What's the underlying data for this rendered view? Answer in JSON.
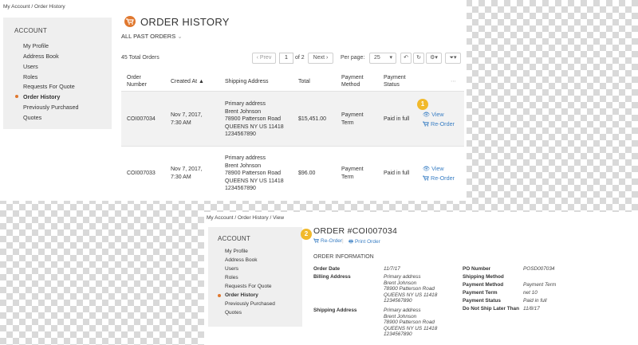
{
  "order_history": {
    "breadcrumb": "My Account / Order History",
    "sidebar": {
      "title": "ACCOUNT",
      "items": [
        "My Profile",
        "Address Book",
        "Users",
        "Roles",
        "Requests For Quote",
        "Order History",
        "Previously Purchased",
        "Quotes"
      ],
      "active": "Order History"
    },
    "page_title": "ORDER HISTORY",
    "filter_label": "ALL PAST ORDERS",
    "total": "45 Total Orders",
    "pager": {
      "prev": "‹ Prev",
      "page": "1",
      "of": "of 2",
      "next": "Next ›",
      "per_page_label": "Per page:",
      "per_page_value": "25"
    },
    "columns": [
      "Order\nNumber",
      "Created At ▲",
      "Shipping Address",
      "Total",
      "Payment\nMethod",
      "Payment\nStatus",
      "⋯"
    ],
    "orders": [
      {
        "number": "COI007034",
        "created": "Nov 7, 2017,\n7:30 AM",
        "address": "Primary address\nBrent Johnson\n78900 Patterson Road\nQUEENS NY US 11418\n1234567890",
        "total": "$15,451.00",
        "method": "Payment\nTerm",
        "status": "Paid in full",
        "view": "View",
        "reorder": "Re-Order"
      },
      {
        "number": "COI007033",
        "created": "Nov 7, 2017,\n7:30 AM",
        "address": "Primary address\nBrent Johnson\n78900 Patterson Road\nQUEENS NY US 11418\n1234567890",
        "total": "$96.00",
        "method": "Payment\nTerm",
        "status": "Paid in full",
        "view": "View",
        "reorder": "Re-Order"
      }
    ],
    "badge": "1"
  },
  "order_view": {
    "breadcrumb": "My Account / Order History / View",
    "sidebar": {
      "title": "ACCOUNT",
      "items": [
        "My Profile",
        "Address Book",
        "Users",
        "Roles",
        "Requests For Quote",
        "Order History",
        "Previously Purchased",
        "Quotes"
      ],
      "active": "Order History"
    },
    "title": "ORDER #COI007034",
    "reorder": "Re-Order",
    "print": "Print Order",
    "badge": "2",
    "section": "ORDER INFORMATION",
    "left": [
      {
        "label": "Order Date",
        "value": "11/7/17"
      },
      {
        "label": "Billing Address",
        "value": "Primary address\nBrent Johnson\n78900 Patterson Road\nQUEENS NY US 11418\n1234567890"
      },
      {
        "label": "Shipping Address",
        "value": "Primary address\nBrent Johnson\n78900 Patterson Road\nQUEENS NY US 11418\n1234567890"
      }
    ],
    "right": [
      {
        "label": "PO Number",
        "value": "POSD007034"
      },
      {
        "label": "Shipping Method",
        "value": ""
      },
      {
        "label": "Payment Method",
        "value": "Payment Term"
      },
      {
        "label": "Payment Term",
        "value": "net 10"
      },
      {
        "label": "Payment Status",
        "value": "Paid in full"
      },
      {
        "label": "Do Not Ship Later Than",
        "value": "11/8/17"
      }
    ]
  },
  "colors": {
    "accent": "#e0782f",
    "link": "#3a7fc4",
    "badge": "#f1b92b",
    "sidebar_bg": "#efefef"
  }
}
